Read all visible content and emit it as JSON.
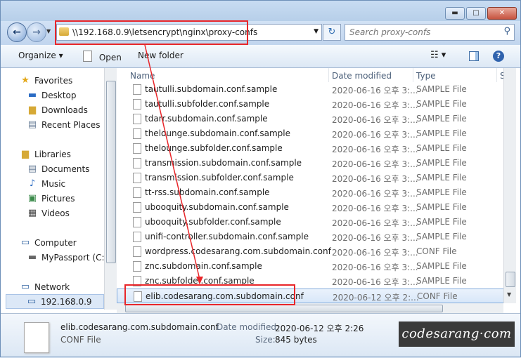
{
  "window": {
    "minimize_glyph": "▬",
    "maximize_glyph": "□",
    "close_glyph": "✕"
  },
  "navbar": {
    "back_glyph": "←",
    "forward_glyph": "→",
    "address": "\\\\192.168.0.9\\letsencrypt\\nginx\\proxy-confs",
    "address_drop_glyph": "▼",
    "refresh_glyph": "↻",
    "search_placeholder": "Search proxy-confs",
    "search_glyph": "⚲"
  },
  "toolbar": {
    "organize": "Organize ▾",
    "open": "Open",
    "new_folder": "New folder",
    "views_glyph": "☷ ▾",
    "help_glyph": "?"
  },
  "sidebar": {
    "favorites": "Favorites",
    "desktop": "Desktop",
    "downloads": "Downloads",
    "recent_places": "Recent Places",
    "libraries": "Libraries",
    "documents": "Documents",
    "music": "Music",
    "pictures": "Pictures",
    "videos": "Videos",
    "computer": "Computer",
    "mypassport": "MyPassport (C:)",
    "network": "Network",
    "ip": "192.168.0.9"
  },
  "columns": {
    "name": "Name",
    "date": "Date modified",
    "type": "Type",
    "size": "S"
  },
  "files": [
    {
      "name": "tautulli.subdomain.conf.sample",
      "date": "2020-06-16 오후 3:...",
      "type": "SAMPLE File"
    },
    {
      "name": "tautulli.subfolder.conf.sample",
      "date": "2020-06-16 오후 3:...",
      "type": "SAMPLE File"
    },
    {
      "name": "tdarr.subdomain.conf.sample",
      "date": "2020-06-16 오후 3:...",
      "type": "SAMPLE File"
    },
    {
      "name": "thelounge.subdomain.conf.sample",
      "date": "2020-06-16 오후 3:...",
      "type": "SAMPLE File"
    },
    {
      "name": "thelounge.subfolder.conf.sample",
      "date": "2020-06-16 오후 3:...",
      "type": "SAMPLE File"
    },
    {
      "name": "transmission.subdomain.conf.sample",
      "date": "2020-06-16 오후 3:...",
      "type": "SAMPLE File"
    },
    {
      "name": "transmission.subfolder.conf.sample",
      "date": "2020-06-16 오후 3:...",
      "type": "SAMPLE File"
    },
    {
      "name": "tt-rss.subdomain.conf.sample",
      "date": "2020-06-16 오후 3:...",
      "type": "SAMPLE File"
    },
    {
      "name": "ubooquity.subdomain.conf.sample",
      "date": "2020-06-16 오후 3:...",
      "type": "SAMPLE File"
    },
    {
      "name": "ubooquity.subfolder.conf.sample",
      "date": "2020-06-16 오후 3:...",
      "type": "SAMPLE File"
    },
    {
      "name": "unifi-controller.subdomain.conf.sample",
      "date": "2020-06-16 오후 3:...",
      "type": "SAMPLE File"
    },
    {
      "name": "wordpress.codesarang.com.subdomain.conf",
      "date": "2020-06-16 오후 3:...",
      "type": "CONF File"
    },
    {
      "name": "znc.subdomain.conf.sample",
      "date": "2020-06-16 오후 3:...",
      "type": "SAMPLE File"
    },
    {
      "name": "znc.subfolder.conf.sample",
      "date": "2020-06-16 오후 3:...",
      "type": "SAMPLE File"
    },
    {
      "name": "elib.codesarang.com.subdomain.conf",
      "date": "2020-06-12 오후 2:...",
      "type": "CONF File"
    }
  ],
  "details": {
    "name": "elib.codesarang.com.subdomain.conf",
    "type": "CONF File",
    "date_label": "Date modified:",
    "date_value": "2020-06-12 오후 2:26",
    "size_label": "Size:",
    "size_value": "845 bytes"
  },
  "watermark": "codesarang·com",
  "colors": {
    "highlight": "#e8262a",
    "selection": "#d8e7f9"
  }
}
